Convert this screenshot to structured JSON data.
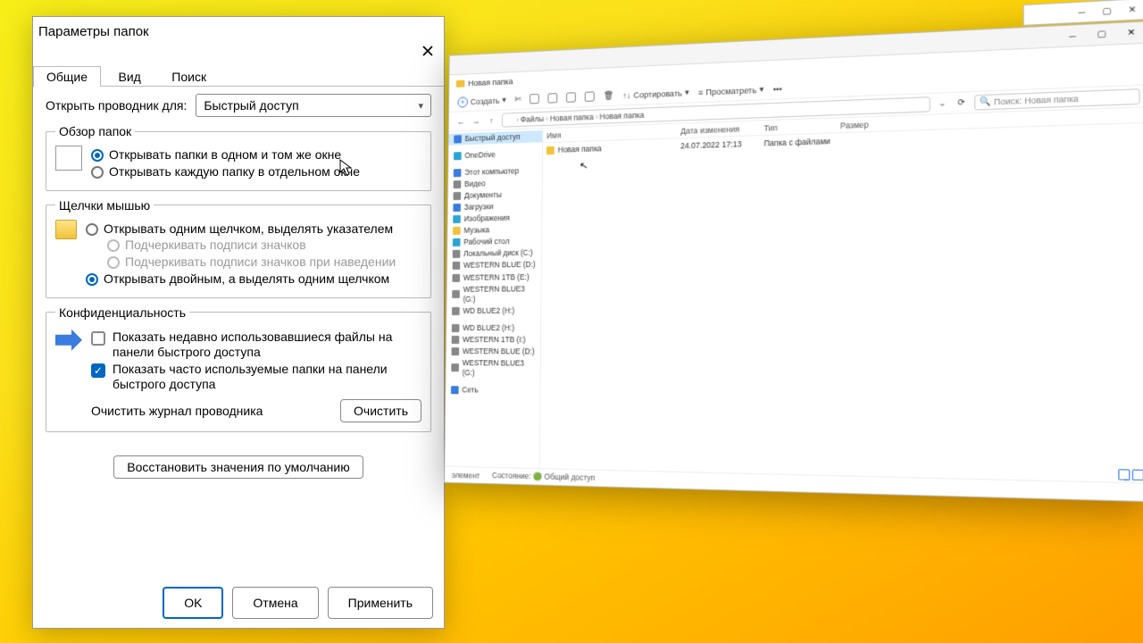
{
  "dialog": {
    "title": "Параметры папок",
    "tabs": {
      "general": "Общие",
      "view": "Вид",
      "search": "Поиск"
    },
    "open_label": "Открыть проводник для:",
    "open_value": "Быстрый доступ",
    "browse": {
      "legend": "Обзор папок",
      "r1": "Открывать папки в одном и том же окне",
      "r2": "Открывать каждую папку в отдельном окне"
    },
    "clicks": {
      "legend": "Щелчки мышью",
      "r1": "Открывать одним щелчком, выделять указателем",
      "r1a": "Подчеркивать подписи значков",
      "r1b": "Подчеркивать подписи значков при наведении",
      "r2": "Открывать двойным, а выделять одним щелчком"
    },
    "privacy": {
      "legend": "Конфиденциальность",
      "c1": "Показать недавно использовавшиеся файлы на панели быстрого доступа",
      "c2": "Показать часто используемые папки на панели быстрого доступа",
      "clear_label": "Очистить журнал проводника",
      "clear_btn": "Очистить"
    },
    "restore": "Восстановить значения по умолчанию",
    "ok": "OK",
    "cancel": "Отмена",
    "apply": "Применить"
  },
  "explorer": {
    "parent_title": "",
    "tab_title": "Новая папка",
    "toolbar": {
      "create": "Создать",
      "sort": "Сортировать",
      "view": "Просматреть"
    },
    "breadcrumb": [
      "Файлы",
      "Новая папка",
      "Новая папка"
    ],
    "search_placeholder": "Поиск: Новая папка",
    "columns": {
      "name": "Имя",
      "date": "Дата изменения",
      "type": "Тип",
      "size": "Размер"
    },
    "row": {
      "name": "Новая папка",
      "date": "24.07.2022 17:13",
      "type": "Папка с файлами",
      "size": ""
    },
    "sidebar": {
      "quick": "Быстрый доступ",
      "onedrive": "OneDrive",
      "thispc": "Этот компьютер",
      "video": "Видео",
      "docs": "Документы",
      "downloads": "Загрузки",
      "pictures": "Изображения",
      "music": "Музыка",
      "desktop": "Рабочий стол",
      "cdisk": "Локальный диск (C:)",
      "d1": "WESTERN BLUE (D:)",
      "d2": "WESTERN 1TB (E:)",
      "d3": "WESTERN BLUE3 (G:)",
      "d4": "WD BLUE2 (H:)",
      "d5": "WD BLUE2 (H:)",
      "d6": "WESTERN 1TB (I:)",
      "d7": "WESTERN BLUE (D:)",
      "d8": "WESTERN BLUE3 (G:)",
      "net": "Сеть"
    },
    "status": {
      "count": "элемент",
      "shared": "Состояние: 🟢 Общий доступ"
    }
  }
}
